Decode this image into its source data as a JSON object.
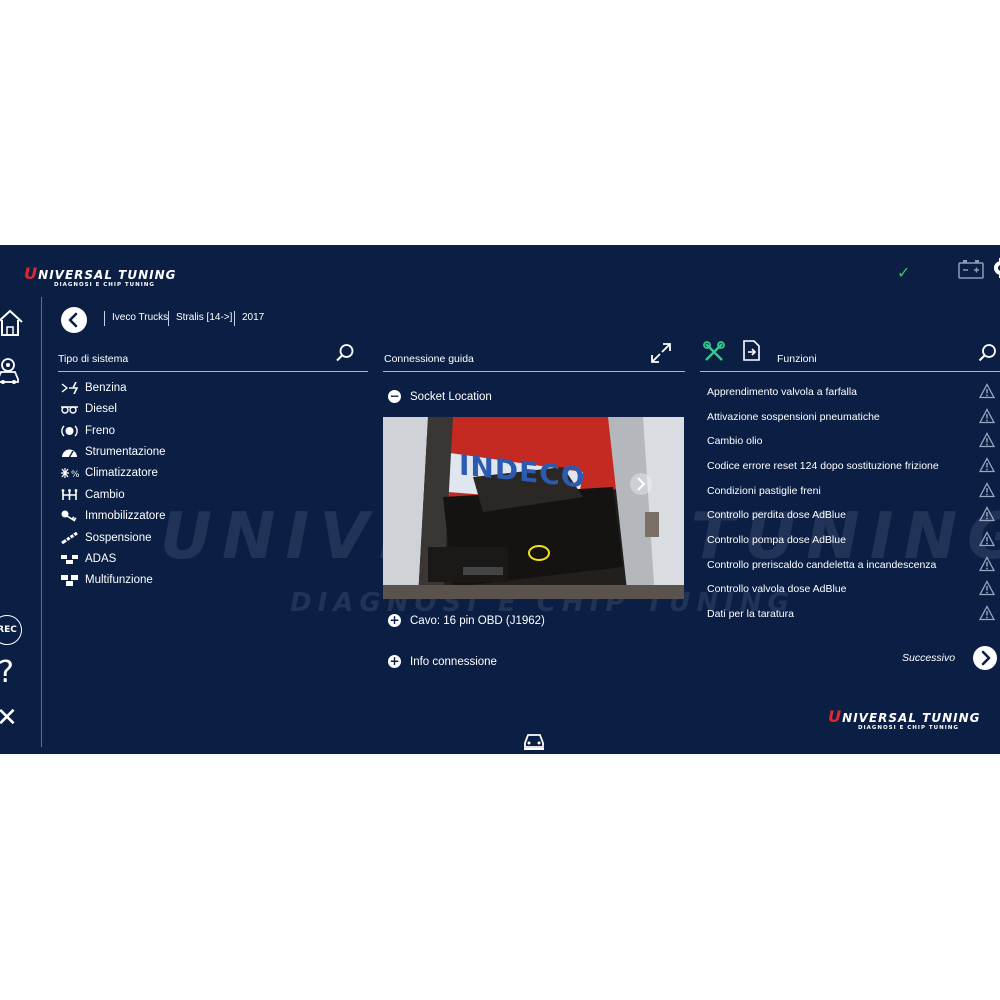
{
  "app": {
    "logo_brand": "NIVERSAL TUNING",
    "logo_tagline": "DIAGNOSI E CHIP TUNING",
    "watermark_brand": "UNIVERSAL TUNING",
    "watermark_tagline": "DIAGNOSI E CHIP TUNING"
  },
  "status": {
    "connection_ok": "✓"
  },
  "sidebar": {
    "items": [
      {
        "icon": "home-icon"
      },
      {
        "icon": "vehicle-settings-icon"
      },
      {
        "icon": "rec-icon",
        "label": "REC"
      },
      {
        "icon": "help-icon",
        "label": "?"
      },
      {
        "icon": "close-icon",
        "label": "✕"
      }
    ]
  },
  "breadcrumb": {
    "items": [
      "Iveco Trucks",
      "Stralis [14->]",
      "2017"
    ]
  },
  "systems": {
    "title": "Tipo di sistema",
    "items": [
      {
        "label": "Benzina",
        "icon": "fuel-spark-icon"
      },
      {
        "label": "Diesel",
        "icon": "glow-plug-icon"
      },
      {
        "label": "Freno",
        "icon": "brake-icon"
      },
      {
        "label": "Strumentazione",
        "icon": "dashboard-icon"
      },
      {
        "label": "Climatizzatore",
        "icon": "climate-icon"
      },
      {
        "label": "Cambio",
        "icon": "gearbox-icon"
      },
      {
        "label": "Immobilizzatore",
        "icon": "key-icon"
      },
      {
        "label": "Sospensione",
        "icon": "suspension-icon"
      },
      {
        "label": "ADAS",
        "icon": "adas-icon"
      },
      {
        "label": "Multifunzione",
        "icon": "multifunction-icon"
      }
    ]
  },
  "connection": {
    "title": "Connessione guida",
    "socket_location": "Socket Location",
    "photo_sign_text": "INDECO",
    "cable": "Cavo: 16 pin OBD (J1962)",
    "info": "Info connessione"
  },
  "functions": {
    "title": "Funzioni",
    "items": [
      "Apprendimento valvola a farfalla",
      "Attivazione sospensioni pneumatiche",
      "Cambio olio",
      "Codice errore reset 124 dopo sostituzione frizione",
      "Condizioni pastiglie freni",
      "Controllo perdita dose AdBlue",
      "Controllo pompa dose AdBlue",
      "Controllo preriscaldo candeletta a incandescenza",
      "Controllo valvola dose AdBlue",
      "Dati per la taratura"
    ],
    "next_label": "Successivo"
  },
  "colors": {
    "background": "#0b1f45",
    "accent_red": "#e0262e",
    "ok_green": "#3fbf5a",
    "tool_green": "#37c98a"
  }
}
